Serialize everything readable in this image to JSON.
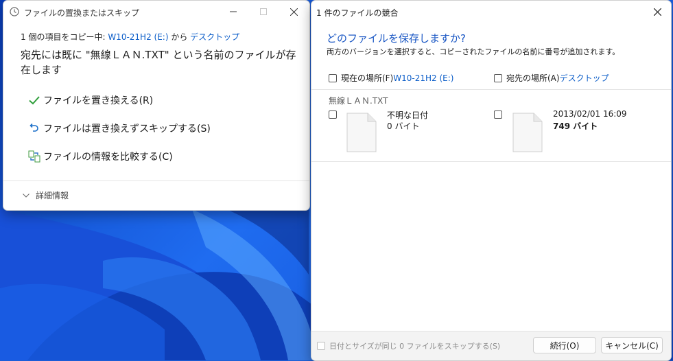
{
  "left_dialog": {
    "title": "ファイルの置換またはスキップ",
    "copy_prefix": "1 個の項目をコピー中: ",
    "source": "W10-21H2 (E:)",
    "from_word": " から ",
    "destination": "デスクトップ",
    "message": "宛先には既に \"無線ＬＡＮ.TXT\" という名前のファイルが存在します",
    "options": {
      "replace": "ファイルを置き換える(R)",
      "skip": "ファイルは置き換えずスキップする(S)",
      "compare": "ファイルの情報を比較する(C)"
    },
    "more_details": "詳細情報"
  },
  "right_dialog": {
    "title": "1 件のファイルの競合",
    "heading": "どのファイルを保存しますか?",
    "description": "両方のバージョンを選択すると、コピーされたファイルの名前に番号が追加されます。",
    "current_label": "現在の場所(F) ",
    "current_link": "W10-21H2 (E:)",
    "dest_label": "宛先の場所(A) ",
    "dest_link": "デスクトップ",
    "file_name": "無線ＬＡＮ.TXT",
    "source_version": {
      "date": "不明な日付",
      "size": "0 バイト"
    },
    "dest_version": {
      "date": "2013/02/01 16:09",
      "size": "749 バイト"
    },
    "skip_same": "日付とサイズが同じ 0 ファイルをスキップする(S)",
    "continue_button": "続行(O)",
    "cancel_button": "キャンセル(C)"
  },
  "icons": {
    "title_icon": "clock-icon",
    "replace_icon": "checkmark-icon",
    "skip_icon": "undo-arrow-icon",
    "compare_icon": "compare-icon",
    "more_icon": "chevron-down-icon",
    "file_icon": "document-icon"
  },
  "colors": {
    "link": "#0a5cc8",
    "heading": "#1a57c4",
    "check": "#2e9e3a",
    "desktop": "#1d5fd6"
  }
}
